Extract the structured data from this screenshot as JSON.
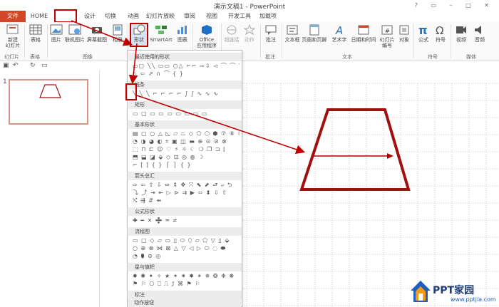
{
  "window": {
    "title": "演示文稿1 - PowerPoint"
  },
  "tabs": [
    "文件",
    "HOME",
    "插入",
    "设计",
    "切换",
    "动画",
    "幻灯片放映",
    "审阅",
    "视图",
    "开发工具",
    "加载项"
  ],
  "ribbon": {
    "new_slide": "新建\n幻灯片",
    "table": "表格",
    "picture": "图片",
    "online_picture": "联机图片",
    "screenshot": "屏幕截图",
    "album": "相册",
    "shapes": "形状",
    "smartart": "SmartArt",
    "chart": "图表",
    "office_apps": "Office\n应用程序",
    "hyperlink": "超链接",
    "action": "动作",
    "comment": "批注",
    "textbox": "文本框",
    "header_footer": "页眉和页脚",
    "wordart": "艺术字",
    "datetime": "日期和时间",
    "slide_number": "幻灯片\n编号",
    "object": "对象",
    "equation": "公式",
    "symbol": "符号",
    "video": "视频",
    "audio": "音频",
    "groups": {
      "slides": "幻灯片",
      "tables": "表格",
      "images": "图像",
      "comments": "批注",
      "text": "文本",
      "symbols": "符号",
      "media": "媒体"
    }
  },
  "slide_pane": {
    "slide_number": "1"
  },
  "dropdown": {
    "sections": [
      "最近使用的形状",
      "线条",
      "矩形",
      "基本形状",
      "箭头总汇",
      "公式形状",
      "流程图",
      "星与旗帜",
      "标注",
      "动作按钮"
    ]
  },
  "watermark": {
    "brand": "PPT家园",
    "url": "www.pptjia.com"
  },
  "colors": {
    "accent": "#d24726",
    "highlight": "#c00000",
    "shape_stroke": "#a01010"
  }
}
